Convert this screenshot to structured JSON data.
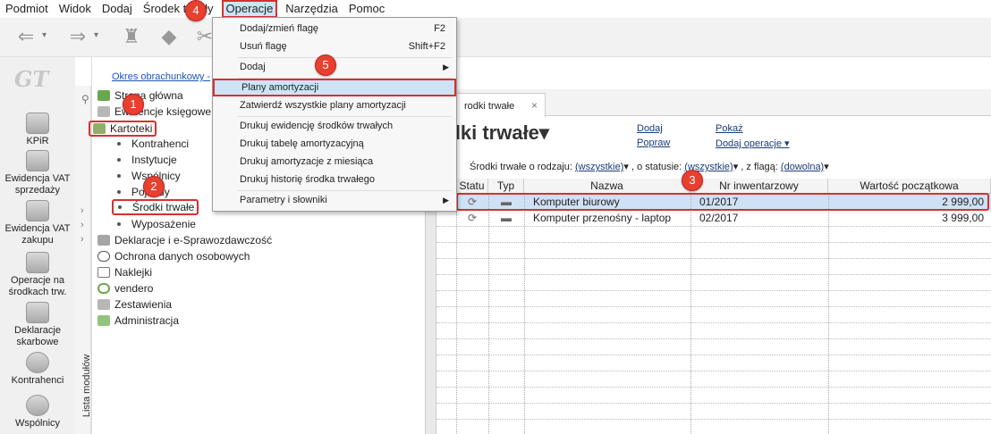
{
  "menubar": [
    "Podmiot",
    "Widok",
    "Dodaj",
    "Środek trwały",
    "Operacje",
    "Narzędzia",
    "Pomoc"
  ],
  "leftbar": {
    "logo": "GT",
    "modules": [
      "KPiR",
      "Ewidencja VAT\nsprzedaży",
      "Ewidencja VAT\nzakupu",
      "Operacje na\nśrodkach trw.",
      "Deklaracje\nskarbowe",
      "Kontrahenci",
      "Wspólnicy"
    ],
    "vertical_label": "Lista modułów"
  },
  "tree": {
    "period_link": "Okres obrachunkowy - ",
    "items": [
      "Strona główna",
      "Ewidencje księgowe",
      "Kartoteki",
      "Kontrahenci",
      "Instytucje",
      "Wspólnicy",
      "Pojazdy",
      "Środki trwałe",
      "Wyposażenie",
      "Deklaracje i e-Sprawozdawczość",
      "Ochrona danych osobowych",
      "Naklejki",
      "vendero",
      "Zestawienia",
      "Administracja"
    ]
  },
  "dropdown": {
    "items": [
      {
        "label": "Dodaj/zmień flagę",
        "shortcut": "F2"
      },
      {
        "label": "Usuń flagę",
        "shortcut": "Shift+F2"
      },
      {
        "label": "Dodaj",
        "submenu": "▶"
      },
      {
        "label": "Plany amortyzacji"
      },
      {
        "label": "Zatwierdź wszystkie plany amortyzacji"
      },
      {
        "label": "Drukuj ewidencję środków trwałych"
      },
      {
        "label": "Drukuj tabelę amortyzacyjną"
      },
      {
        "label": "Drukuj amortyzacje z miesiąca"
      },
      {
        "label": "Drukuj historię środka trwałego"
      },
      {
        "label": "Parametry i słowniki",
        "submenu": "▶"
      }
    ]
  },
  "main": {
    "tab_label": "rodki trwałe",
    "tab_close": "×",
    "title": "odki trwałe▾",
    "actions": [
      "Dodaj",
      "Popraw",
      "Pokaż",
      "Dodaj operacje ▾"
    ],
    "filters": {
      "prefix": "Środki trwałe o rodzaju: ",
      "rodzaj": "(wszystkie)",
      "status_prefix": " , o statusie: ",
      "status": "(wszystkie)",
      "flag_prefix": " , z flagą: ",
      "flag": "(dowolna)",
      "arrow": "▾"
    },
    "columns": [
      "Statu",
      "Typ",
      "Nazwa",
      "Nr inwentarzowy",
      "Wartość początkowa"
    ],
    "rows": [
      {
        "status": "⟳",
        "typ": "▬",
        "nazwa": "Komputer biurowy",
        "nr": "01/2017",
        "wartosc": "2 999,00"
      },
      {
        "status": "⟳",
        "typ": "▬",
        "nazwa": "Komputer przenośny - laptop",
        "nr": "02/2017",
        "wartosc": "3 999,00"
      }
    ]
  },
  "badges": [
    "1",
    "2",
    "3",
    "4",
    "5"
  ],
  "colors": {
    "accent_red": "#d9302f",
    "selection": "#cde4f7",
    "link": "#1a55b8"
  }
}
